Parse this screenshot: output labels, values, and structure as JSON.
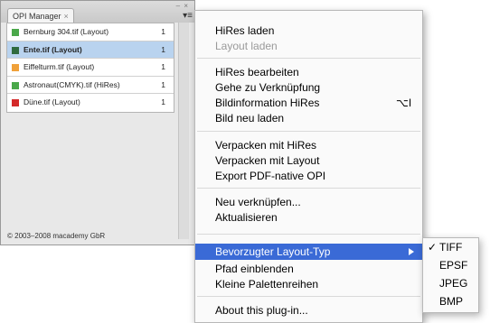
{
  "palette": {
    "tab_title": "OPI Manager",
    "tab_close": "×",
    "minmax": "–  ×",
    "menu_glyph": "▾≡",
    "rows": [
      {
        "name": "Bernburg 304.tif (Layout)",
        "count": "1",
        "color": "#4aa84a"
      },
      {
        "name": "Ente.tif (Layout)",
        "count": "1",
        "color": "#2f6b3f"
      },
      {
        "name": "Eiffelturm.tif (Layout)",
        "count": "1",
        "color": "#f0a13a"
      },
      {
        "name": "Astronaut(CMYK).tif (HiRes)",
        "count": "1",
        "color": "#4aa84a"
      },
      {
        "name": "Düne.tif (Layout)",
        "count": "1",
        "color": "#d42a2a"
      }
    ],
    "footer": "© 2003–2008 macademy GbR"
  },
  "menu": {
    "hires_laden": "HiRes laden",
    "layout_laden": "Layout laden",
    "hires_bearbeiten": "HiRes bearbeiten",
    "gehe_zu": "Gehe zu Verknüpfung",
    "bildinfo": "Bildinformation HiRes",
    "bildinfo_shortcut": "⌥I",
    "bild_neu": "Bild neu laden",
    "verpacken_hires": "Verpacken mit HiRes",
    "verpacken_layout": "Verpacken mit Layout",
    "export_pdf": "Export PDF-native OPI",
    "neu_verknuepfen": "Neu verknüpfen...",
    "aktualisieren": "Aktualisieren",
    "bevorzugter": "Bevorzugter Layout-Typ",
    "pfad": "Pfad einblenden",
    "kleine": "Kleine Palettenreihen",
    "about": "About this plug-in..."
  },
  "submenu": {
    "check": "✓",
    "items": [
      "TIFF",
      "EPSF",
      "JPEG",
      "BMP"
    ]
  }
}
